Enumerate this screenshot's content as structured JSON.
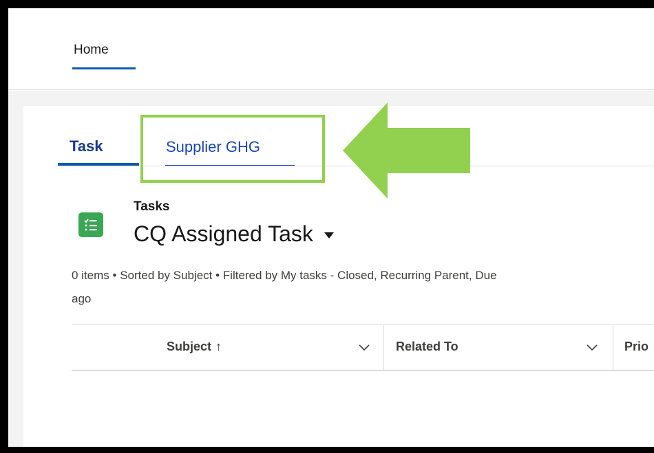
{
  "nav": {
    "home_label": "Home"
  },
  "tabs": [
    {
      "label": "Task",
      "active": true
    },
    {
      "label": "Supplier GHG",
      "active": false
    }
  ],
  "list": {
    "object_label": "Tasks",
    "title": "CQ Assigned Task",
    "meta": "0 items • Sorted by Subject • Filtered by My tasks - Closed, Recurring Parent, Due",
    "meta_wrap": "ago"
  },
  "table": {
    "columns": [
      {
        "label": "Subject",
        "sort": "↑"
      },
      {
        "label": "Related To"
      },
      {
        "label": "Prio"
      }
    ]
  },
  "colors": {
    "accent": "#0b5cab",
    "highlight": "#92d050",
    "tasks_icon": "#3ba755"
  },
  "icons": {
    "tasks": "checklist-icon",
    "list_dropdown": "caret-down-icon",
    "column_menu": "chevron-down-icon"
  }
}
